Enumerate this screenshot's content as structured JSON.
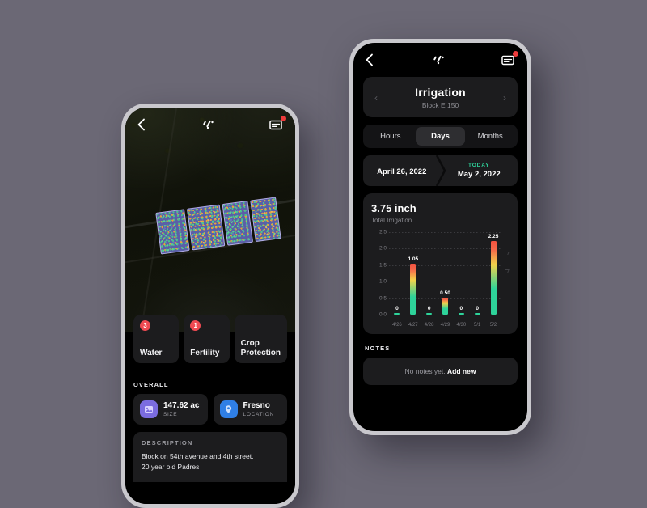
{
  "appbar": {
    "back_icon": "chevron-left-icon",
    "logo_icon": "brand-logo-icon",
    "mail_icon": "inbox-icon",
    "has_notification": true
  },
  "left_phone": {
    "map": {
      "alt": "satellite-field-map",
      "plot_count": 4
    },
    "task_cards": [
      {
        "label": "Water",
        "badge": "3"
      },
      {
        "label": "Fertility",
        "badge": "1"
      },
      {
        "label": "Crop Protection",
        "badge": ""
      }
    ],
    "overall": {
      "section_label": "OVERALL",
      "stats": [
        {
          "value": "147.62 ac",
          "sub": "SIZE",
          "icon": "field-size-icon",
          "color": "#7b6ce0"
        },
        {
          "value": "Fresno",
          "sub": "LOCATION",
          "icon": "location-pin-icon",
          "color": "#2f7fe6"
        }
      ]
    },
    "description": {
      "label": "DESCRIPTION",
      "line1": "Block on 54th avenue and 4th street.",
      "line2": "20 year old Padres"
    }
  },
  "right_phone": {
    "title_card": {
      "title": "Irrigation",
      "subtitle": "Block E 150",
      "prev_icon": "chevron-left-icon",
      "next_icon": "chevron-right-icon"
    },
    "segments": [
      {
        "label": "Hours",
        "active": false
      },
      {
        "label": "Days",
        "active": true
      },
      {
        "label": "Months",
        "active": false
      }
    ],
    "date_range": {
      "start": "April 26, 2022",
      "today_label": "TODAY",
      "end": "May 2, 2022"
    },
    "summary": {
      "value": "3.75 inch",
      "label": "Total Irrigation"
    },
    "notes": {
      "section_label": "NOTES",
      "empty_text": "No notes yet.",
      "action": "Add new"
    }
  },
  "chart_data": {
    "type": "bar",
    "title": "3.75 inch",
    "subtitle": "Total Irrigation",
    "xlabel": "",
    "ylabel": "",
    "unit": "inch",
    "categories": [
      "4/26",
      "4/27",
      "4/28",
      "4/29",
      "4/30",
      "5/1",
      "5/2"
    ],
    "values": [
      0,
      1.05,
      0,
      0.5,
      0,
      0,
      2.25
    ],
    "bar_labels": [
      "0",
      "1.05",
      "0",
      "0.50",
      "0",
      "0",
      "2.25"
    ],
    "bar_heights": [
      0,
      1.55,
      0,
      0.52,
      0,
      0,
      2.22
    ],
    "ylim": [
      0,
      2.5
    ],
    "yticks": [
      "0.0",
      "0.5",
      "1.0",
      "1.5",
      "2.0",
      "2.5"
    ],
    "grid": true,
    "legend": "none",
    "colors": {
      "low": "#2ed39a",
      "mid": "#f2d24b",
      "high": "#f56a4b",
      "top": "#f4513f"
    }
  },
  "theme": {
    "background": "#6b6875",
    "screen": "#000000",
    "card": "#1c1c1e",
    "accent_green": "#2ed39a",
    "badge_red": "#ef4a52",
    "bezel": "#c9c8cd"
  }
}
